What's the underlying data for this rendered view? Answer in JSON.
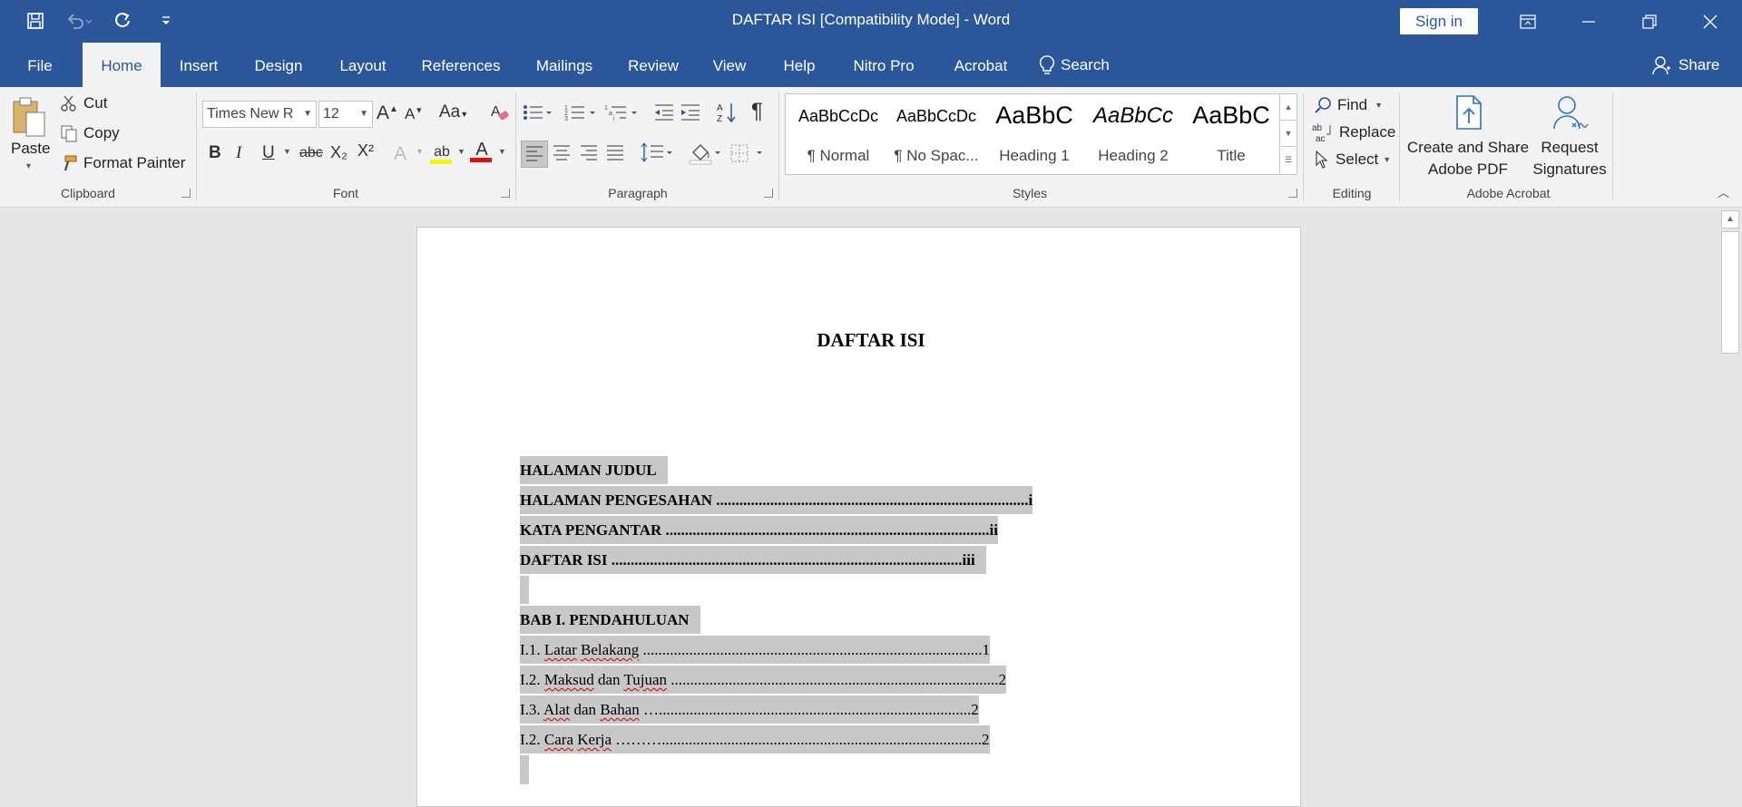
{
  "window": {
    "title": "DAFTAR ISI [Compatibility Mode]  -  Word",
    "sign_in": "Sign in"
  },
  "tabs": [
    "File",
    "Home",
    "Insert",
    "Design",
    "Layout",
    "References",
    "Mailings",
    "Review",
    "View",
    "Help",
    "Nitro Pro",
    "Acrobat"
  ],
  "active_tab": "Home",
  "search_label": "Search",
  "share_label": "Share",
  "clipboard": {
    "paste": "Paste",
    "cut": "Cut",
    "copy": "Copy",
    "format_painter": "Format Painter",
    "group": "Clipboard"
  },
  "font": {
    "name": "Times New R",
    "size": "12",
    "group": "Font",
    "grow": "A",
    "shrink": "A",
    "change_case": "Aa",
    "bold": "B",
    "italic": "I",
    "underline": "U",
    "strike": "abc",
    "subscript": "X₂",
    "superscript": "X²",
    "text_effects": "A",
    "highlight": "ab",
    "font_color": "A"
  },
  "paragraph": {
    "group": "Paragraph",
    "show_marks": "¶"
  },
  "styles": {
    "group": "Styles",
    "items": [
      {
        "sample": "AaBbCcDc",
        "name": "¶ Normal"
      },
      {
        "sample": "AaBbCcDc",
        "name": "¶ No Spac..."
      },
      {
        "sample": "AaBbC",
        "name": "Heading 1"
      },
      {
        "sample": "AaBbCc",
        "name": "Heading 2"
      },
      {
        "sample": "AaBbC",
        "name": "Title"
      }
    ]
  },
  "editing": {
    "group": "Editing",
    "find": "Find",
    "replace": "Replace",
    "select": "Select"
  },
  "acrobat": {
    "group": "Adobe Acrobat",
    "create_line1": "Create and Share",
    "create_line2": "Adobe PDF",
    "request_line1": "Request",
    "request_line2": "Signatures"
  },
  "document": {
    "title": "DAFTAR ISI",
    "front_matter": [
      {
        "text": "HALAMAN JUDUL"
      },
      {
        "text": "HALAMAN PENGESAHAN .................................................................................i"
      },
      {
        "text": "KATA PENGANTAR ....................................................................................ii"
      },
      {
        "text": "DAFTAR ISI ...........................................................................................iii"
      }
    ],
    "chapter": "BAB I. PENDAHULUAN",
    "entries": [
      {
        "num": "I.1. ",
        "w1": "Latar",
        "mid": " ",
        "w2": "Belakang",
        "dots": " ........................................................................................1"
      },
      {
        "num": "I.2. ",
        "w1": "Maksud",
        "mid": " dan ",
        "w2": "Tujuan",
        "dots": " .....................................................................................2"
      },
      {
        "num": "I.3. ",
        "w1": "Alat",
        "mid": " dan ",
        "w2": "Bahan",
        "dots": " ….................................................................................2"
      },
      {
        "num": "I.2. ",
        "w1": "Cara",
        "mid": " ",
        "w2": "Kerja",
        "dots": " ………...................................................................................2"
      }
    ]
  },
  "colors": {
    "title_bar": "#2b579a",
    "ribbon": "#f3f3f3",
    "selection": "#c8c8c8"
  }
}
